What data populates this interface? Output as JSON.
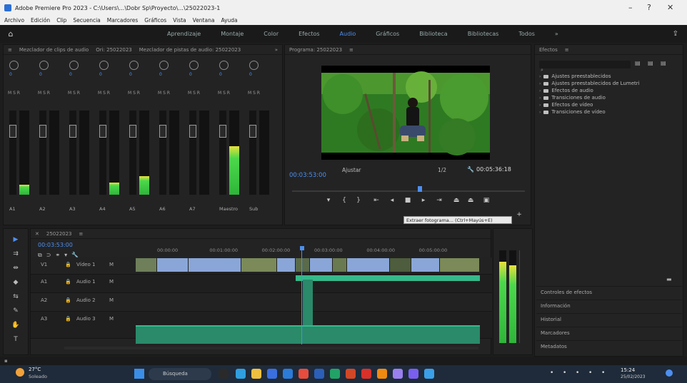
{
  "window": {
    "title": "Adobe Premiere Pro 2023 - C:\\Users\\...\\Dobr Sp\\Proyecto\\...\\25022023-1",
    "controls": [
      "–",
      "?",
      "✕"
    ]
  },
  "menu": [
    "Archivo",
    "Edición",
    "Clip",
    "Secuencia",
    "Marcadores",
    "Gráficos",
    "Vista",
    "Ventana",
    "Ayuda"
  ],
  "workspaces": {
    "items": [
      "Aprendizaje",
      "Montaje",
      "Color",
      "Efectos",
      "Audio",
      "Gráficos",
      "Biblioteca",
      "Bibliotecas",
      "Todos"
    ],
    "active_index": 4
  },
  "mixer": {
    "tab_label": "Mezclador de clips de audio",
    "source_label": "Ori: 25022023",
    "mixer_label": "Mezclador de pistas de audio: 25022023",
    "channels": [
      {
        "name": "A1",
        "level": 0.12,
        "meter": 0.12
      },
      {
        "name": "A2",
        "level": 0.0,
        "meter": 0.0
      },
      {
        "name": "A3",
        "level": 0.0,
        "meter": 0.0
      },
      {
        "name": "A4",
        "level": 0.14,
        "meter": 0.14
      },
      {
        "name": "A5",
        "level": 0.22,
        "meter": 0.22
      },
      {
        "name": "A6",
        "level": 0.0,
        "meter": 0.0
      },
      {
        "name": "A7",
        "level": 0.0,
        "meter": 0.0
      },
      {
        "name": "Maestro",
        "level": 0.58,
        "meter": 0.58
      },
      {
        "name": "Sub",
        "level": 0.0,
        "meter": 0.0
      }
    ]
  },
  "program": {
    "tab_label": "Programa: 25022023",
    "timecode_in": "00:03:53:00",
    "fit_label": "Ajustar",
    "scale": "1/2",
    "timecode_out": "00:05:36:18",
    "playhead_position": 0.55,
    "tooltip": "Extraer fotograma... (Ctrl+Mayús+E)"
  },
  "effects": {
    "tab_label": "Efectos",
    "search_placeholder": "",
    "tree": [
      "Ajustes preestablecidos",
      "Ajustes preestablecidos de Lumetri",
      "Efectos de audio",
      "Transiciones de audio",
      "Efectos de vídeo",
      "Transiciones de vídeo"
    ],
    "bottom_panels": [
      "Controles de efectos",
      "Información",
      "Historial",
      "Marcadores",
      "Metadatos"
    ]
  },
  "timeline": {
    "tab_label": "25022023",
    "timecode": "00:03:53:00",
    "ruler": [
      "00:00:00",
      "00:01:00:00",
      "00:02:00:00",
      "00:03:00:00",
      "00:04:00:00",
      "00:05:00:00"
    ],
    "tracks": [
      {
        "name": "V1",
        "label": "Vídeo 1"
      },
      {
        "name": "A1",
        "label": "Audio 1"
      },
      {
        "name": "A2",
        "label": "Audio 2"
      },
      {
        "name": "A3",
        "label": "Audio 3"
      }
    ]
  },
  "audio_meter": {
    "left_level": 0.88,
    "right_level": 0.84
  },
  "taskbar": {
    "weather_temp": "27°C",
    "weather_desc": "Soleado",
    "search_placeholder": "Búsqueda",
    "time": "15:24",
    "date": "25/02/2023"
  },
  "colors": {
    "accent": "#4d8ff0",
    "meter_green": "#2fb53a",
    "clip_video": "#8aa6d8",
    "clip_audio": "#35b98a"
  }
}
